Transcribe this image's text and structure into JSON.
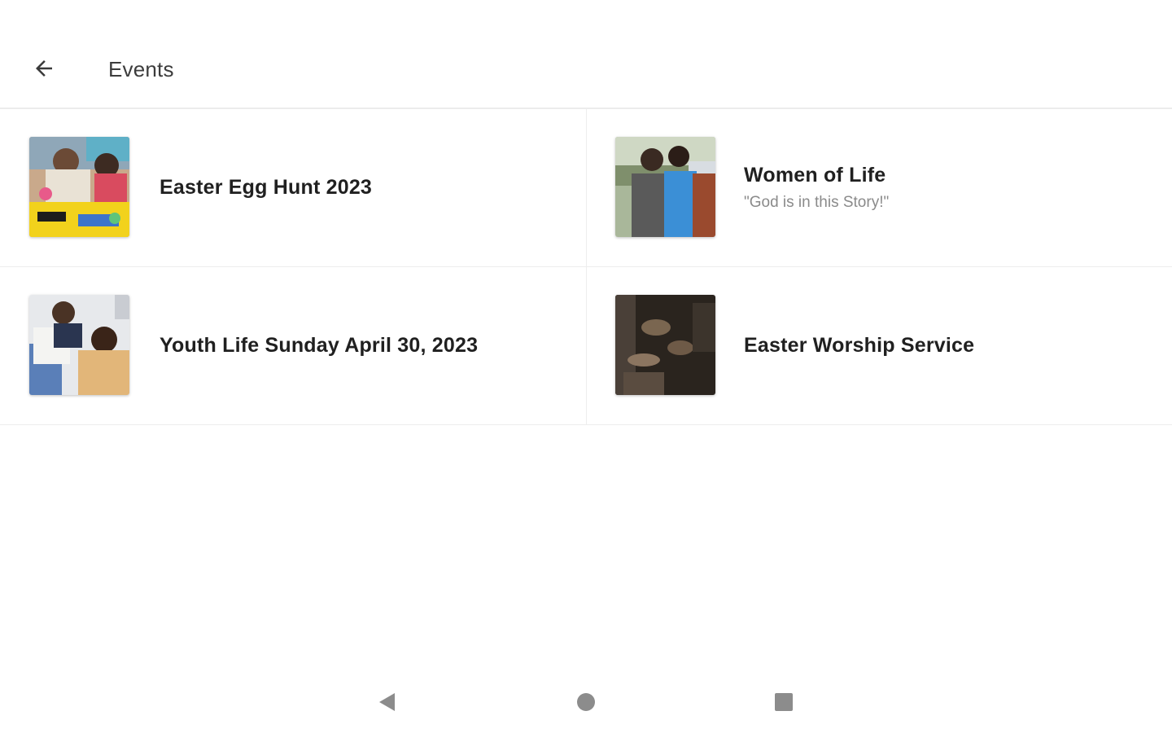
{
  "header": {
    "title": "Events",
    "back_icon": "arrow-left-icon"
  },
  "events": [
    {
      "title": "Easter Egg Hunt 2023",
      "subtitle": ""
    },
    {
      "title": "Women of Life",
      "subtitle": "\"God is in this Story!\""
    },
    {
      "title": "Youth Life Sunday April 30, 2023",
      "subtitle": ""
    },
    {
      "title": "Easter Worship Service",
      "subtitle": ""
    }
  ],
  "navbar": {
    "back_icon": "nav-back-triangle-icon",
    "home_icon": "nav-home-circle-icon",
    "recents_icon": "nav-recents-square-icon"
  },
  "colors": {
    "background": "#ffffff",
    "divider": "#ededed",
    "title_text": "#202020",
    "subtitle_text": "#8a8a8a",
    "nav_icon": "#8c8c8c"
  }
}
